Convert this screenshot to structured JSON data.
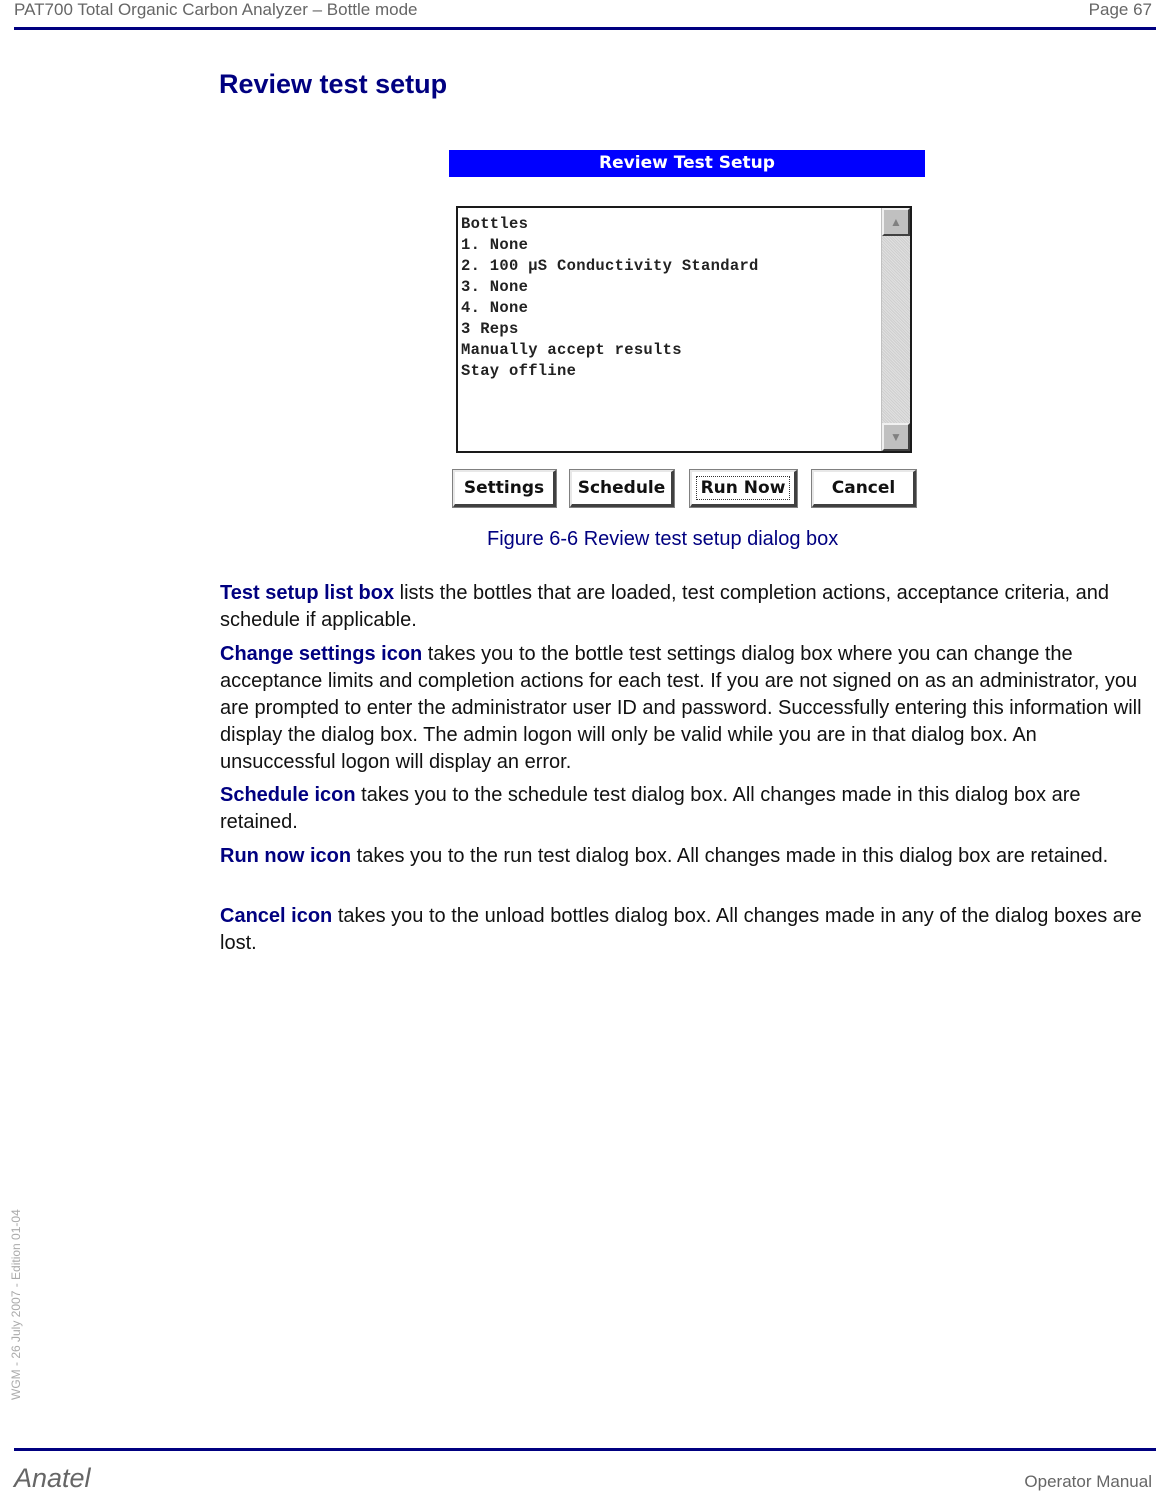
{
  "header": {
    "doc_title": "PAT700 Total Organic Carbon Analyzer – Bottle mode",
    "page": "Page 67"
  },
  "section_title": "Review test setup",
  "dialog": {
    "title": "Review Test Setup",
    "list_lines": [
      "Bottles",
      "1. None",
      "2. 100 µS Conductivity Standard",
      "3. None",
      "4. None",
      "3 Reps",
      "Manually accept results",
      "Stay offline"
    ],
    "scroll_up_icon": "▲",
    "scroll_down_icon": "▼",
    "buttons": {
      "settings": "Settings",
      "schedule": "Schedule",
      "run_now": "Run Now",
      "cancel": "Cancel"
    }
  },
  "figure_caption": "Figure 6-6 Review test setup dialog box",
  "paragraphs": [
    {
      "term": "Test setup list box",
      "text": " lists the bottles that are loaded, test completion actions, acceptance criteria, and schedule if applicable."
    },
    {
      "term": "Change settings icon",
      "text": " takes you to the bottle test settings dialog box where you can change the acceptance limits and completion actions for each test. If you are not signed on as an administrator, you are prompted to enter the administrator user ID and password. Successfully entering this information will display the dialog box. The admin logon will only be valid while you are in that dialog box. An unsuccessful logon will display an error."
    },
    {
      "term": "Schedule icon",
      "text": " takes you to the schedule test dialog box. All changes made in this dialog box are retained."
    },
    {
      "term": "Run now icon",
      "text": " takes you to the run test dialog box. All changes made in this dialog box are retained."
    },
    {
      "term": "Cancel icon",
      "text": " takes you to the unload bottles dialog box. All changes made in any of the dialog boxes are lost."
    }
  ],
  "side_note": "WGM - 26 July 2007 - Edition 01-04",
  "footer": {
    "brand": "Anatel",
    "manual": "Operator Manual"
  }
}
